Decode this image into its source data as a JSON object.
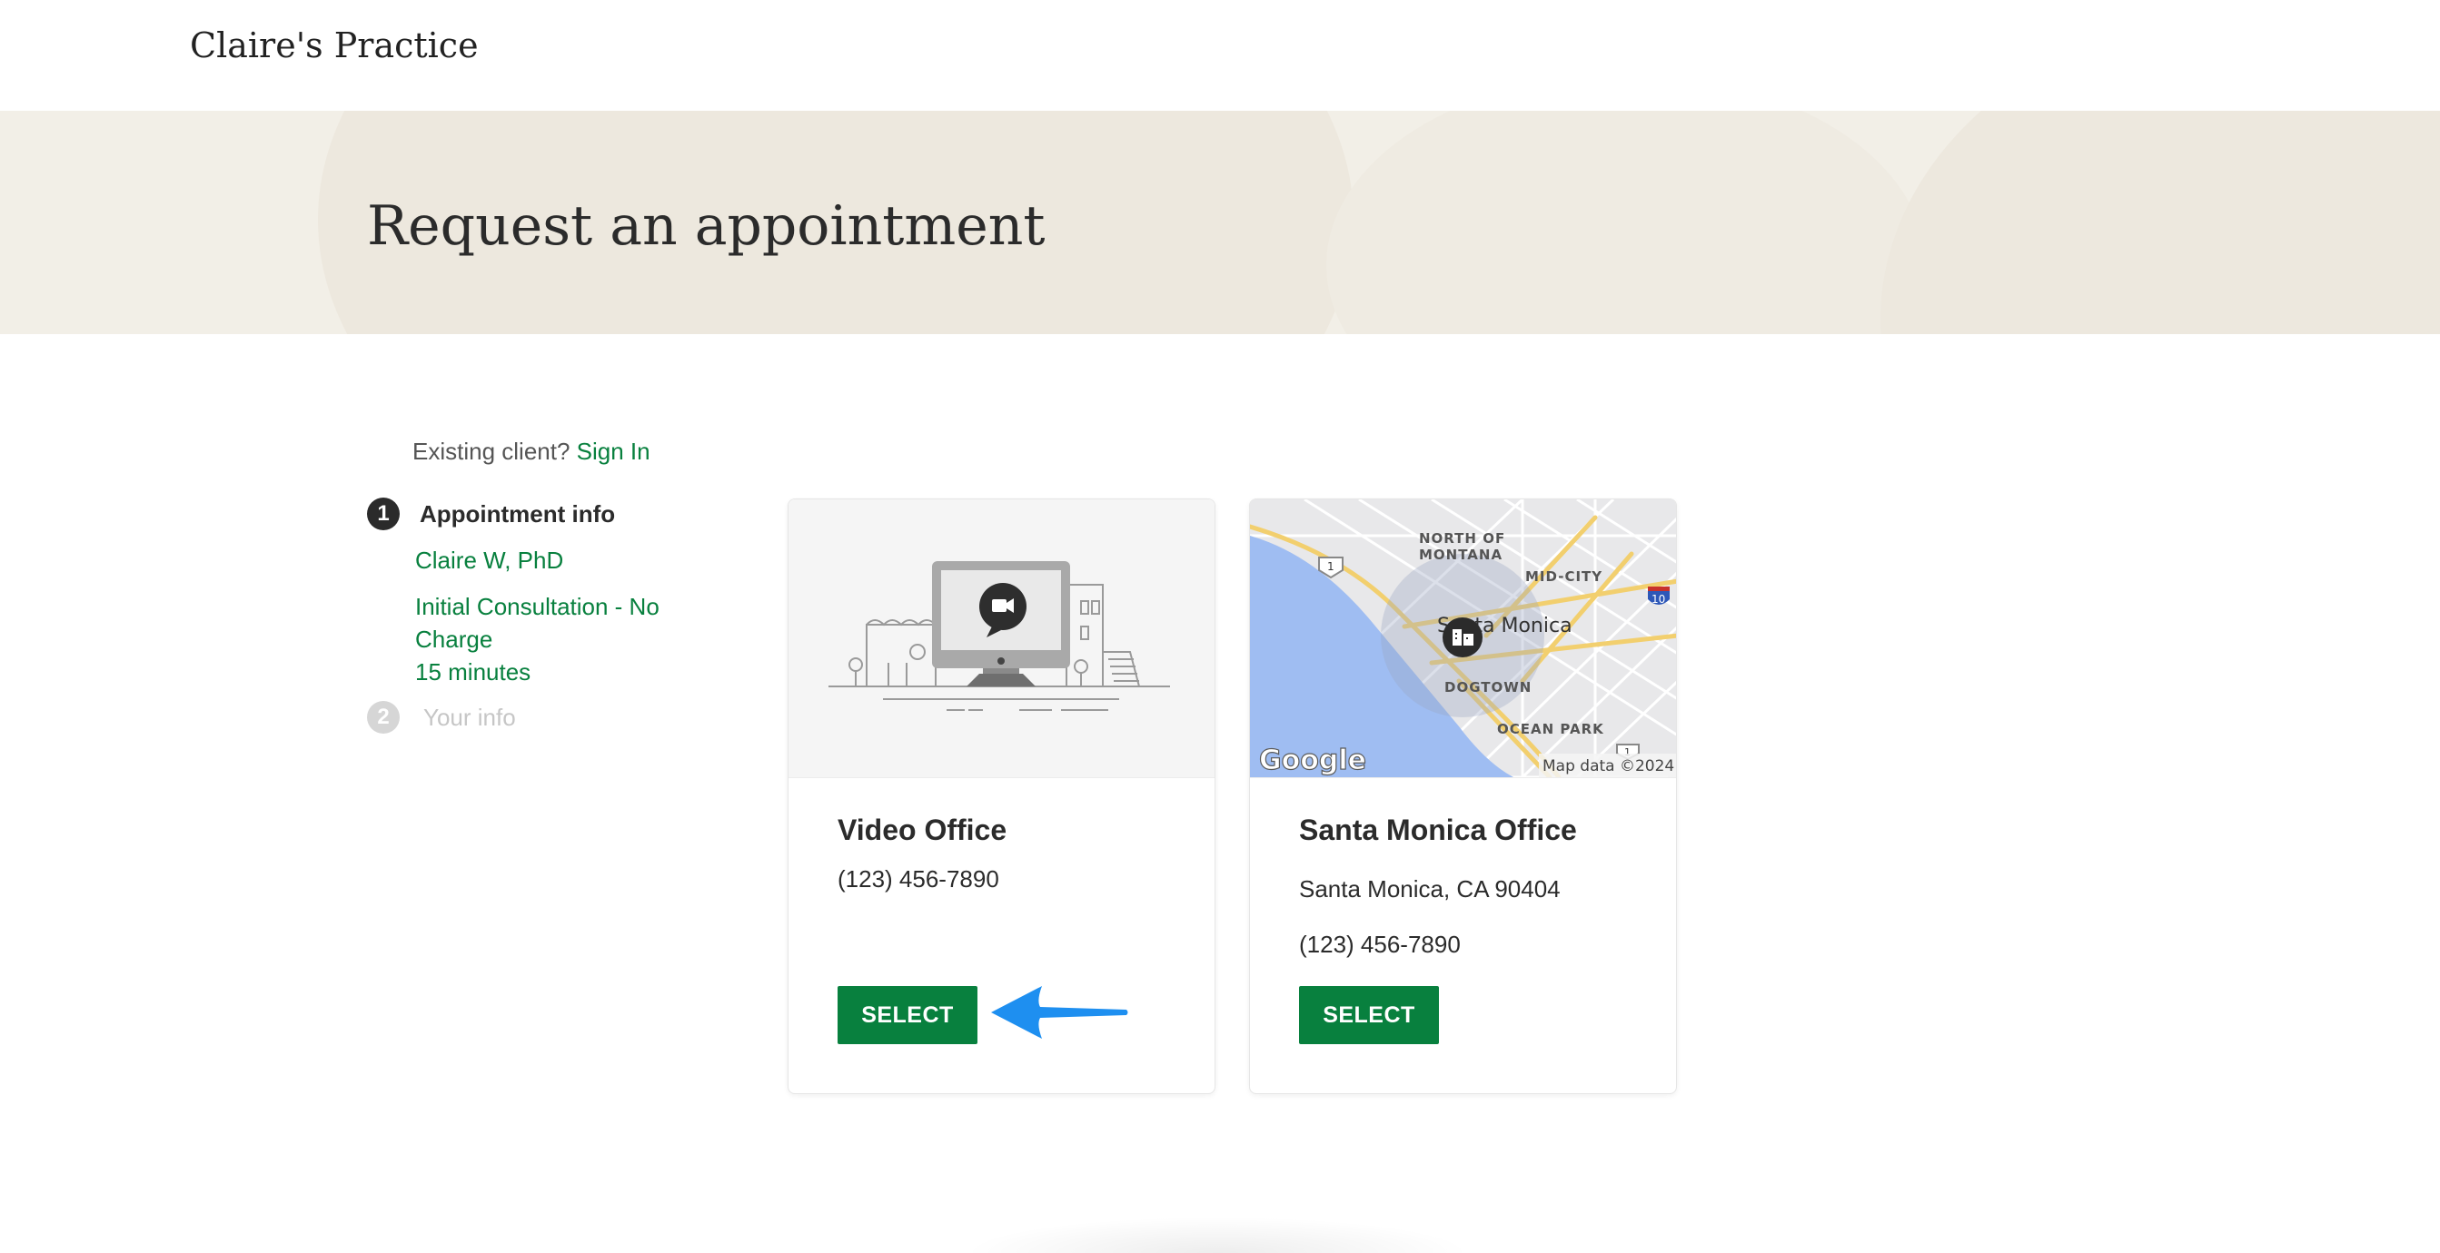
{
  "header": {
    "practice_name": "Claire's Practice"
  },
  "hero": {
    "title": "Request an appointment"
  },
  "sidebar": {
    "existing_prompt": "Existing client?",
    "sign_in_label": "Sign In",
    "steps": [
      {
        "number": "1",
        "label": "Appointment info",
        "details": {
          "clinician": "Claire W, PhD",
          "service": "Initial Consultation - No Charge",
          "duration": "15 minutes"
        }
      },
      {
        "number": "2",
        "label": "Your info"
      }
    ]
  },
  "offices": [
    {
      "name": "Video Office",
      "phone": "(123) 456-7890",
      "button_label": "SELECT",
      "media_icon": "video-office-illustration"
    },
    {
      "name": "Santa Monica Office",
      "address": "Santa Monica, CA 90404",
      "phone": "(123) 456-7890",
      "button_label": "SELECT",
      "map": {
        "city_label": "Santa Monica",
        "neighborhoods": [
          "NORTH OF",
          "MONTANA",
          "MID-CITY",
          "DOGTOWN",
          "OCEAN PARK"
        ],
        "route_badges": [
          "1",
          "10",
          "1"
        ],
        "logo_text": "Google",
        "attribution": "Map data ©2024"
      }
    }
  ],
  "colors": {
    "accent_green": "#08803e",
    "hero_bg": "#f2efe7",
    "arrow_blue": "#1e8ff0",
    "map_water": "#9fbdf2"
  }
}
